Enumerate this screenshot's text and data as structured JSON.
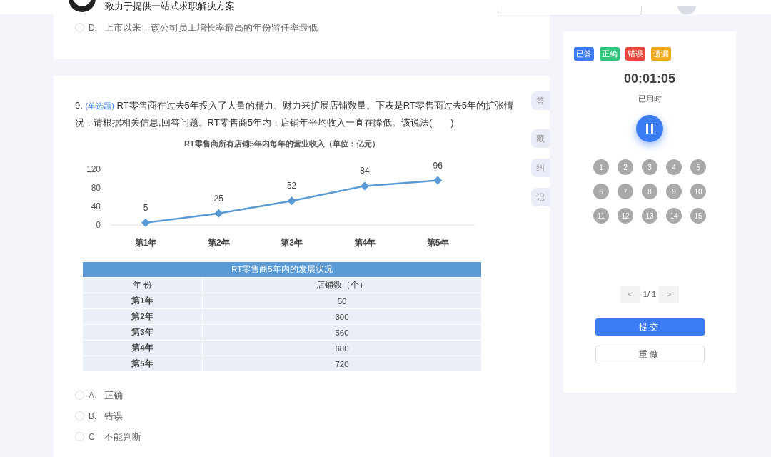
{
  "header": {
    "tagline": "致力于提供一站式求职解决方案"
  },
  "previous_question": {
    "options": [
      {
        "letter": "D.",
        "text": "上市以来，该公司员工增长率最高的年份留任率最低",
        "selected": false
      }
    ]
  },
  "question": {
    "number": "9.",
    "type": "(单选题)",
    "stem": "RT零售商在过去5年投入了大量的精力、财力来扩展店铺数量。下表是RT零售商过去5年的扩张情况，请根据相关信息,回答问题。RT零售商5年内，店铺年平均收入一直在降低。该说法(　　)",
    "chart_data": {
      "type": "line",
      "title": "RT零售商所有店铺5年内每年的营业收入（单位：亿元）",
      "categories": [
        "第1年",
        "第2年",
        "第3年",
        "第4年",
        "第5年"
      ],
      "series": [
        {
          "color": "#5b9bd5",
          "marker": "diamond",
          "values": [
            5,
            25,
            52,
            84,
            96
          ]
        }
      ],
      "ylim": [
        0,
        120
      ],
      "yticks": [
        0,
        40,
        80,
        120
      ],
      "data_labels": true
    },
    "table": {
      "title": "RT零售商5年内的发展状况",
      "columns": [
        "年 份",
        "店铺数（个）"
      ],
      "rows": [
        [
          "第1年",
          "50"
        ],
        [
          "第2年",
          "300"
        ],
        [
          "第3年",
          "560"
        ],
        [
          "第4年",
          "680"
        ],
        [
          "第5年",
          "720"
        ]
      ]
    },
    "options": [
      {
        "letter": "A.",
        "text": "正确",
        "selected": false
      },
      {
        "letter": "B.",
        "text": "错误",
        "selected": false
      },
      {
        "letter": "C.",
        "text": "不能判断",
        "selected": false
      }
    ]
  },
  "side_tabs": [
    {
      "label": "答"
    },
    {
      "label": "藏"
    },
    {
      "label": "纠"
    },
    {
      "label": "记"
    }
  ],
  "panel": {
    "legend": [
      {
        "label": "已答",
        "color": "#3b7cf5"
      },
      {
        "label": "正确",
        "color": "#2fc57a"
      },
      {
        "label": "错误",
        "color": "#e8453c"
      },
      {
        "label": "遗漏",
        "color": "#f0a81c"
      }
    ],
    "timer": "00:01:05",
    "timer_label": "已用时",
    "questions": [
      "1",
      "2",
      "3",
      "4",
      "5",
      "6",
      "7",
      "8",
      "9",
      "10",
      "11",
      "12",
      "13",
      "14",
      "15"
    ],
    "pager": {
      "prev": "<",
      "page": "1/ 1",
      "next": ">"
    },
    "submit": "提交",
    "redo": "重做"
  }
}
